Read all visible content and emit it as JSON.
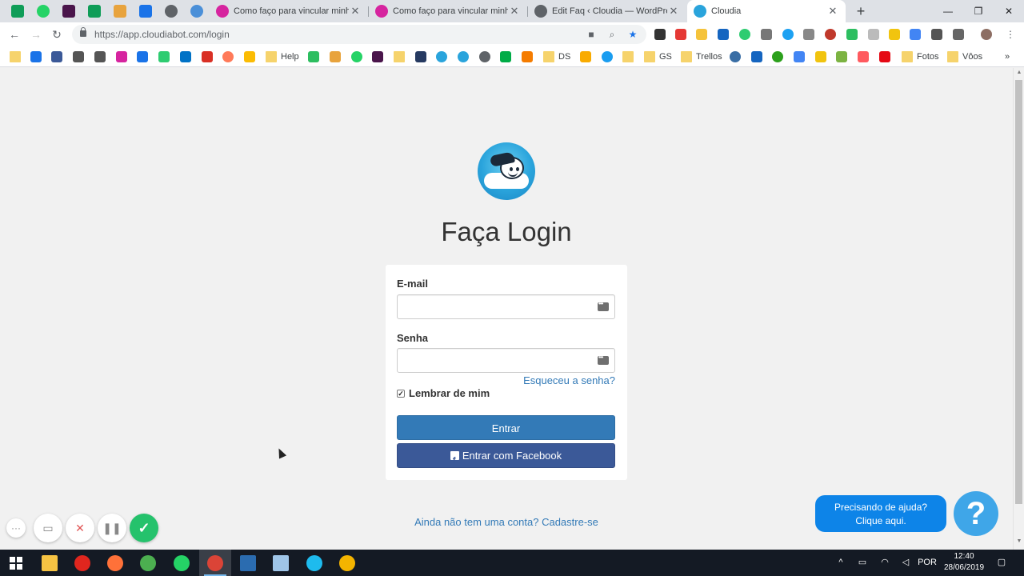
{
  "browser": {
    "pinned_tabs": [
      {
        "icon": "sheets-icon",
        "color": "#0f9d58"
      },
      {
        "icon": "whatsapp-icon",
        "color": "#25d366"
      },
      {
        "icon": "slack-icon",
        "color": "#4a154b"
      },
      {
        "icon": "sheets-icon",
        "color": "#0f9d58"
      },
      {
        "icon": "checkmark-icon",
        "color": "#e8a33d"
      },
      {
        "icon": "flow-icon",
        "color": "#1a73e8"
      },
      {
        "icon": "globe-icon",
        "color": "#5f6368"
      },
      {
        "icon": "person-icon",
        "color": "#4a8fd8"
      }
    ],
    "tabs": [
      {
        "title": "Como faço para vincular minha c",
        "icon": "instagram-icon",
        "color": "#d6249f"
      },
      {
        "title": "Como faço para vincular minha c",
        "icon": "instagram-icon",
        "color": "#d6249f"
      },
      {
        "title": "Edit Faq ‹ Cloudia — WordPress",
        "icon": "wordpress-icon",
        "color": "#5f6368"
      },
      {
        "title": "Cloudia",
        "icon": "cloudia-icon",
        "color": "#2aa4dc",
        "active": true
      }
    ],
    "close_glyph": "✕",
    "new_tab_glyph": "+",
    "window_controls": {
      "minimize": "—",
      "maximize": "❐",
      "close": "✕"
    },
    "url": "https://app.cloudiabot.com/login",
    "bookmarks": {
      "help": "Help",
      "ds": "DS",
      "gs": "GS",
      "trellos": "Trellos",
      "fotos": "Fotos",
      "voos": "Vôos",
      "more": "»"
    }
  },
  "login": {
    "title": "Faça Login",
    "email_label": "E-mail",
    "email_value": "",
    "password_label": "Senha",
    "password_value": "",
    "forgot_link": "Esqueceu a senha?",
    "remember_label": "Lembrar de mim",
    "remember_checked": true,
    "submit_label": "Entrar",
    "facebook_label": "Entrar com Facebook",
    "signup_link": "Ainda não tem uma conta? Cadastre-se"
  },
  "help_widget": {
    "line1": "Precisando de ajuda?",
    "line2": "Clique aqui.",
    "button_glyph": "?"
  },
  "recorder": {
    "more": "···",
    "cancel": "✕",
    "pause": "❚❚",
    "done": "✓"
  },
  "taskbar": {
    "language": "POR",
    "time": "12:40",
    "date": "28/06/2019"
  },
  "colors": {
    "primary": "#337ab7",
    "facebook": "#3b5998",
    "help": "#0d84e8",
    "background": "#f1f1f1"
  }
}
